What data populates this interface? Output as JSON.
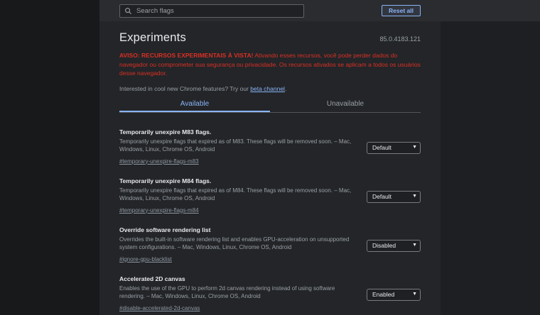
{
  "colors": {
    "accent": "#8ab4f8",
    "warning": "#d93025"
  },
  "header": {
    "search_placeholder": "Search flags",
    "reset_all_label": "Reset all"
  },
  "page": {
    "title": "Experiments",
    "version": "85.0.4183.121",
    "warning_bold": "AVISO: RECURSOS EXPERIMENTAIS À VISTA!",
    "warning_rest": " Ativando esses recursos, você pode perder dados do navegador ou comprometer sua segurança ou privacidade. Os recursos ativados se aplicam a todos os usuários desse navegador.",
    "promo_prefix": "Interested in cool new Chrome features? Try our ",
    "promo_link": "beta channel",
    "promo_suffix": "."
  },
  "tabs": [
    {
      "label": "Available",
      "selected": true
    },
    {
      "label": "Unavailable",
      "selected": false
    }
  ],
  "flags": [
    {
      "title": "Temporarily unexpire M83 flags.",
      "description": "Temporarily unexpire flags that expired as of M83. These flags will be removed soon. – Mac, Windows, Linux, Chrome OS, Android",
      "permalink": "#temporary-unexpire-flags-m83",
      "value": "Default"
    },
    {
      "title": "Temporarily unexpire M84 flags.",
      "description": "Temporarily unexpire flags that expired as of M84. These flags will be removed soon. – Mac, Windows, Linux, Chrome OS, Android",
      "permalink": "#temporary-unexpire-flags-m84",
      "value": "Default"
    },
    {
      "title": "Override software rendering list",
      "description": "Overrides the built-in software rendering list and enables GPU-acceleration on unsupported system configurations. – Mac, Windows, Linux, Chrome OS, Android",
      "permalink": "#ignore-gpu-blacklist",
      "value": "Disabled"
    },
    {
      "title": "Accelerated 2D canvas",
      "description": "Enables the use of the GPU to perform 2d canvas rendering instead of using software rendering. – Mac, Windows, Linux, Chrome OS, Android",
      "permalink": "#disable-accelerated-2d-canvas",
      "value": "Enabled"
    }
  ]
}
